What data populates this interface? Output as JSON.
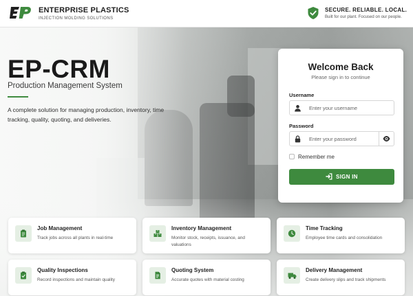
{
  "header": {
    "brand_name": "ENTERPRISE PLASTICS",
    "brand_tagline": "INJECTION MOLDING SOLUTIONS",
    "secure_title": "SECURE. RELIABLE. LOCAL.",
    "secure_subtitle": "Built for our plant. Focused on our people."
  },
  "hero": {
    "title": "EP-CRM",
    "subtitle": "Production Management System",
    "description": "A complete solution for managing production, inventory, time tracking, quality, quoting, and deliveries."
  },
  "login": {
    "title": "Welcome Back",
    "subtitle": "Please sign in to continue",
    "username_label": "Username",
    "username_placeholder": "Enter your username",
    "password_label": "Password",
    "password_placeholder": "Enter your password",
    "remember_label": "Remember me",
    "signin_label": "SIGN IN"
  },
  "features": [
    {
      "title": "Job Management",
      "description": "Track jobs across all plants in real-time",
      "icon": "clipboard-icon"
    },
    {
      "title": "Inventory Management",
      "description": "Monitor stock, receipts, issuance, and valuations",
      "icon": "boxes-icon"
    },
    {
      "title": "Time Tracking",
      "description": "Employee time cards and consolidation",
      "icon": "clock-icon"
    },
    {
      "title": "Quality Inspections",
      "description": "Record inspections and maintain quality",
      "icon": "clipboard-check-icon"
    },
    {
      "title": "Quoting System",
      "description": "Accurate quotes with material costing",
      "icon": "invoice-icon"
    },
    {
      "title": "Delivery Management",
      "description": "Create delivery slips and track shipments",
      "icon": "truck-icon"
    }
  ],
  "colors": {
    "brand_green": "#3e8a3e",
    "icon_bg": "#e5efe4"
  }
}
